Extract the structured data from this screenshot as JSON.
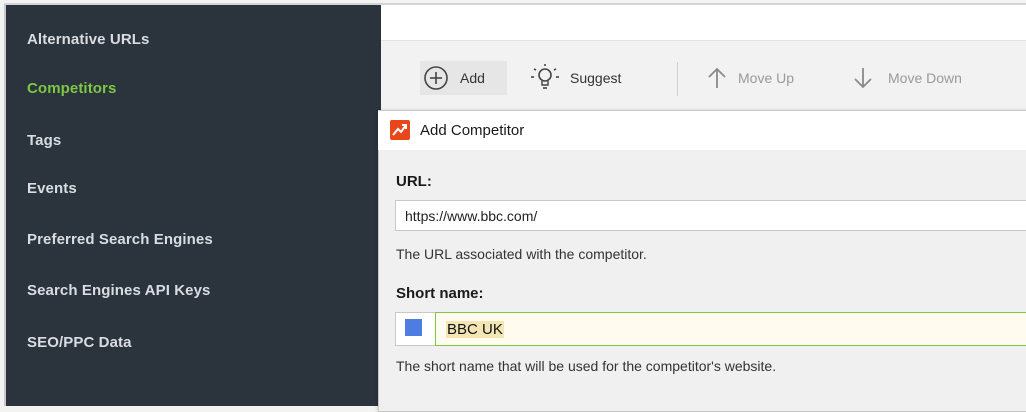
{
  "sidebar": {
    "items": [
      {
        "label": "Alternative URLs",
        "active": false
      },
      {
        "label": "Competitors",
        "active": true
      },
      {
        "label": "Tags",
        "active": false
      },
      {
        "label": "Events",
        "active": false
      },
      {
        "label": "Preferred Search Engines",
        "active": false
      },
      {
        "label": "Search Engines API Keys",
        "active": false
      },
      {
        "label": "SEO/PPC Data",
        "active": false
      }
    ],
    "active_color": "#7cc743",
    "background": "#2b333d"
  },
  "toolbar": {
    "add_label": "Add",
    "suggest_label": "Suggest",
    "move_up_label": "Move Up",
    "move_down_label": "Move Down",
    "icons": [
      "plus-circle-icon",
      "lightbulb-icon",
      "arrow-up-icon",
      "arrow-down-icon"
    ]
  },
  "dialog": {
    "title": "Add Competitor",
    "app_icon": "rank-tracker-icon",
    "url": {
      "label": "URL:",
      "value": "https://www.bbc.com/",
      "hint": "The URL associated with the competitor."
    },
    "short_name": {
      "label": "Short name:",
      "value": "BBC UK",
      "swatch_color": "#4d7de0",
      "hint": "The short name that will be used for the competitor's website."
    }
  }
}
